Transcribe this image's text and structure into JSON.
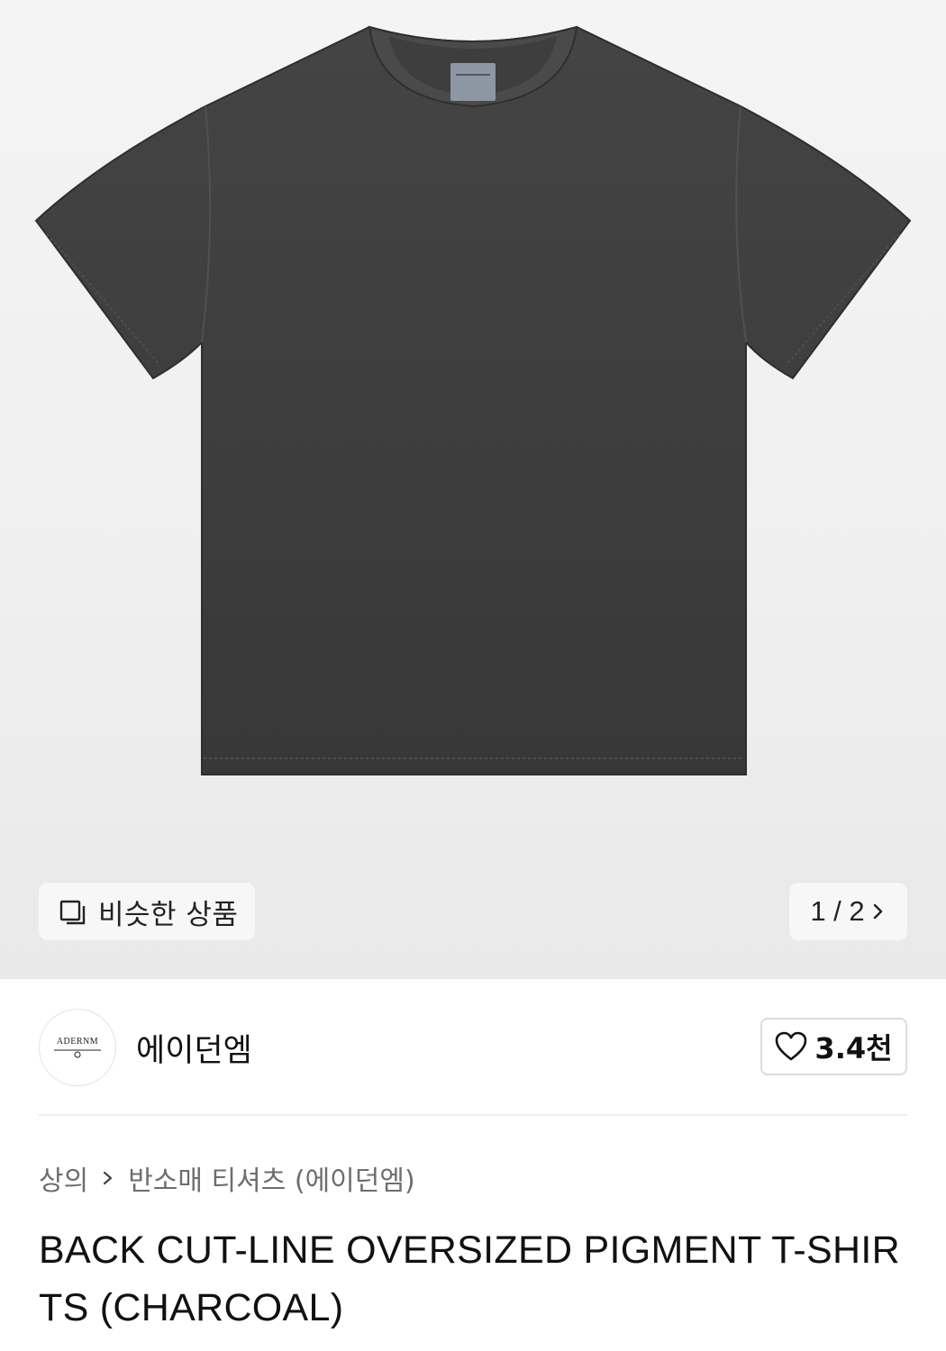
{
  "gallery": {
    "similar_label": "비슷한 상품",
    "pager_text": "1 / 2",
    "current_page": 1,
    "total_pages": 2
  },
  "brand": {
    "name": "에이던엠",
    "logo_text": "ADERNM",
    "like_count": "3.4천"
  },
  "breadcrumb": {
    "items": [
      "상의",
      "반소매 티셔츠 (에이던엠)"
    ]
  },
  "product": {
    "title": "BACK CUT-LINE OVERSIZED PIGMENT T-SHIRTS (CHARCOAL)",
    "color": "#3a3a3a"
  },
  "icons": {
    "similar": "stacked-squares-icon",
    "pager": "chevron-right-icon",
    "like": "heart-outline-icon",
    "breadcrumb_separator": "chevron-right-icon"
  }
}
